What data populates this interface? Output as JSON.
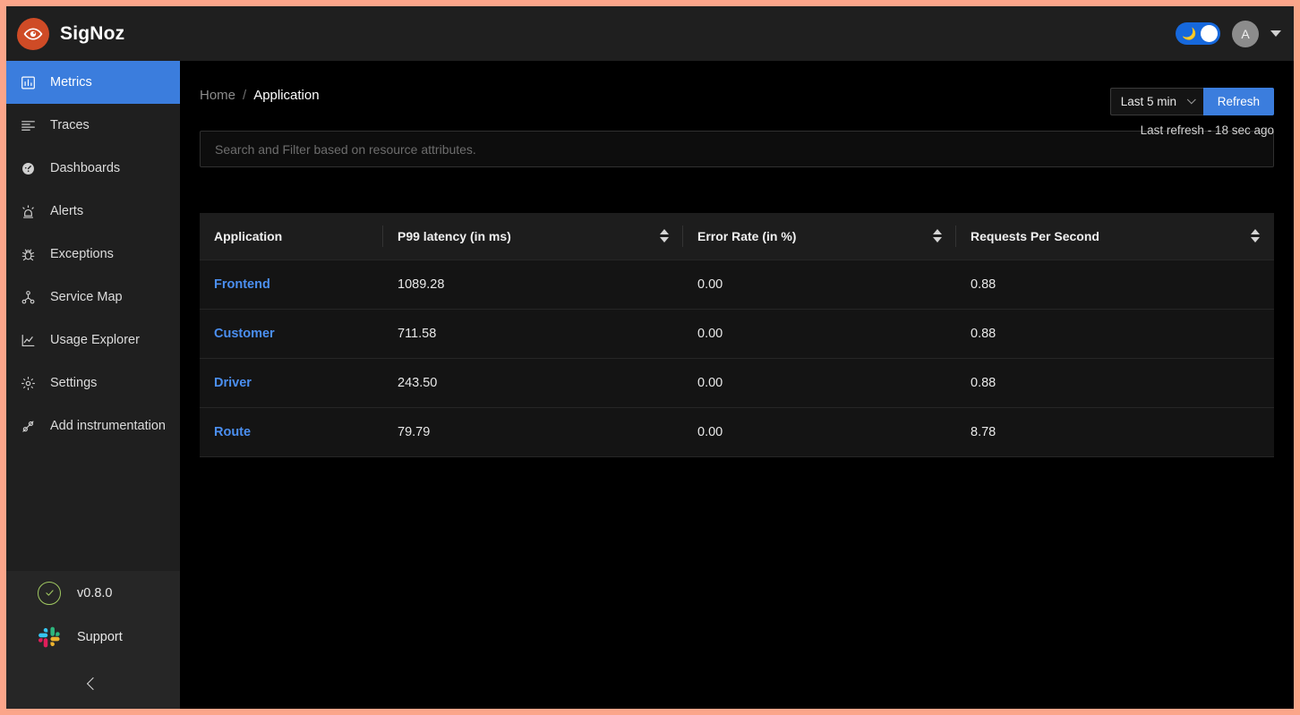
{
  "brand": {
    "name": "SigNoz",
    "logo_icon": "eye-icon",
    "logo_color": "#cf4b26"
  },
  "topbar": {
    "theme_toggle_icon": "moon-icon",
    "theme_toggle_on": true,
    "avatar_initial": "A",
    "account_caret_icon": "caret-down-icon"
  },
  "sidebar": {
    "items": [
      {
        "label": "Metrics",
        "icon": "bar-chart-icon",
        "active": true
      },
      {
        "label": "Traces",
        "icon": "align-left-icon",
        "active": false
      },
      {
        "label": "Dashboards",
        "icon": "dashboard-gauge-icon",
        "active": false
      },
      {
        "label": "Alerts",
        "icon": "alert-siren-icon",
        "active": false
      },
      {
        "label": "Exceptions",
        "icon": "bug-icon",
        "active": false
      },
      {
        "label": "Service Map",
        "icon": "deployment-node-icon",
        "active": false
      },
      {
        "label": "Usage Explorer",
        "icon": "line-chart-icon",
        "active": false
      },
      {
        "label": "Settings",
        "icon": "gear-icon",
        "active": false
      },
      {
        "label": "Add instrumentation",
        "icon": "api-plug-icon",
        "active": false
      }
    ],
    "version": {
      "label": "v0.8.0",
      "icon": "check-circle-icon",
      "icon_color": "#a0c861"
    },
    "support": {
      "label": "Support",
      "icon": "slack-icon"
    },
    "collapse_icon": "chevron-left-icon"
  },
  "breadcrumb": {
    "home": "Home",
    "separator": "/",
    "current": "Application"
  },
  "time_controls": {
    "selected_range": "Last 5 min",
    "chevron_icon": "chevron-down-icon",
    "refresh_label": "Refresh",
    "last_refresh": "Last refresh - 18 sec ago",
    "accent_color": "#3b7ddd"
  },
  "search": {
    "placeholder": "Search and Filter based on resource attributes.",
    "value": ""
  },
  "table": {
    "columns": [
      {
        "label": "Application",
        "sortable": false
      },
      {
        "label": "P99 latency (in ms)",
        "sortable": true
      },
      {
        "label": "Error Rate (in %)",
        "sortable": true
      },
      {
        "label": "Requests Per Second",
        "sortable": true
      }
    ],
    "rows": [
      {
        "application": "Frontend",
        "p99_latency": "1089.28",
        "error_rate": "0.00",
        "rps": "0.88"
      },
      {
        "application": "Customer",
        "p99_latency": "711.58",
        "error_rate": "0.00",
        "rps": "0.88"
      },
      {
        "application": "Driver",
        "p99_latency": "243.50",
        "error_rate": "0.00",
        "rps": "0.88"
      },
      {
        "application": "Route",
        "p99_latency": "79.79",
        "error_rate": "0.00",
        "rps": "8.78"
      }
    ]
  }
}
